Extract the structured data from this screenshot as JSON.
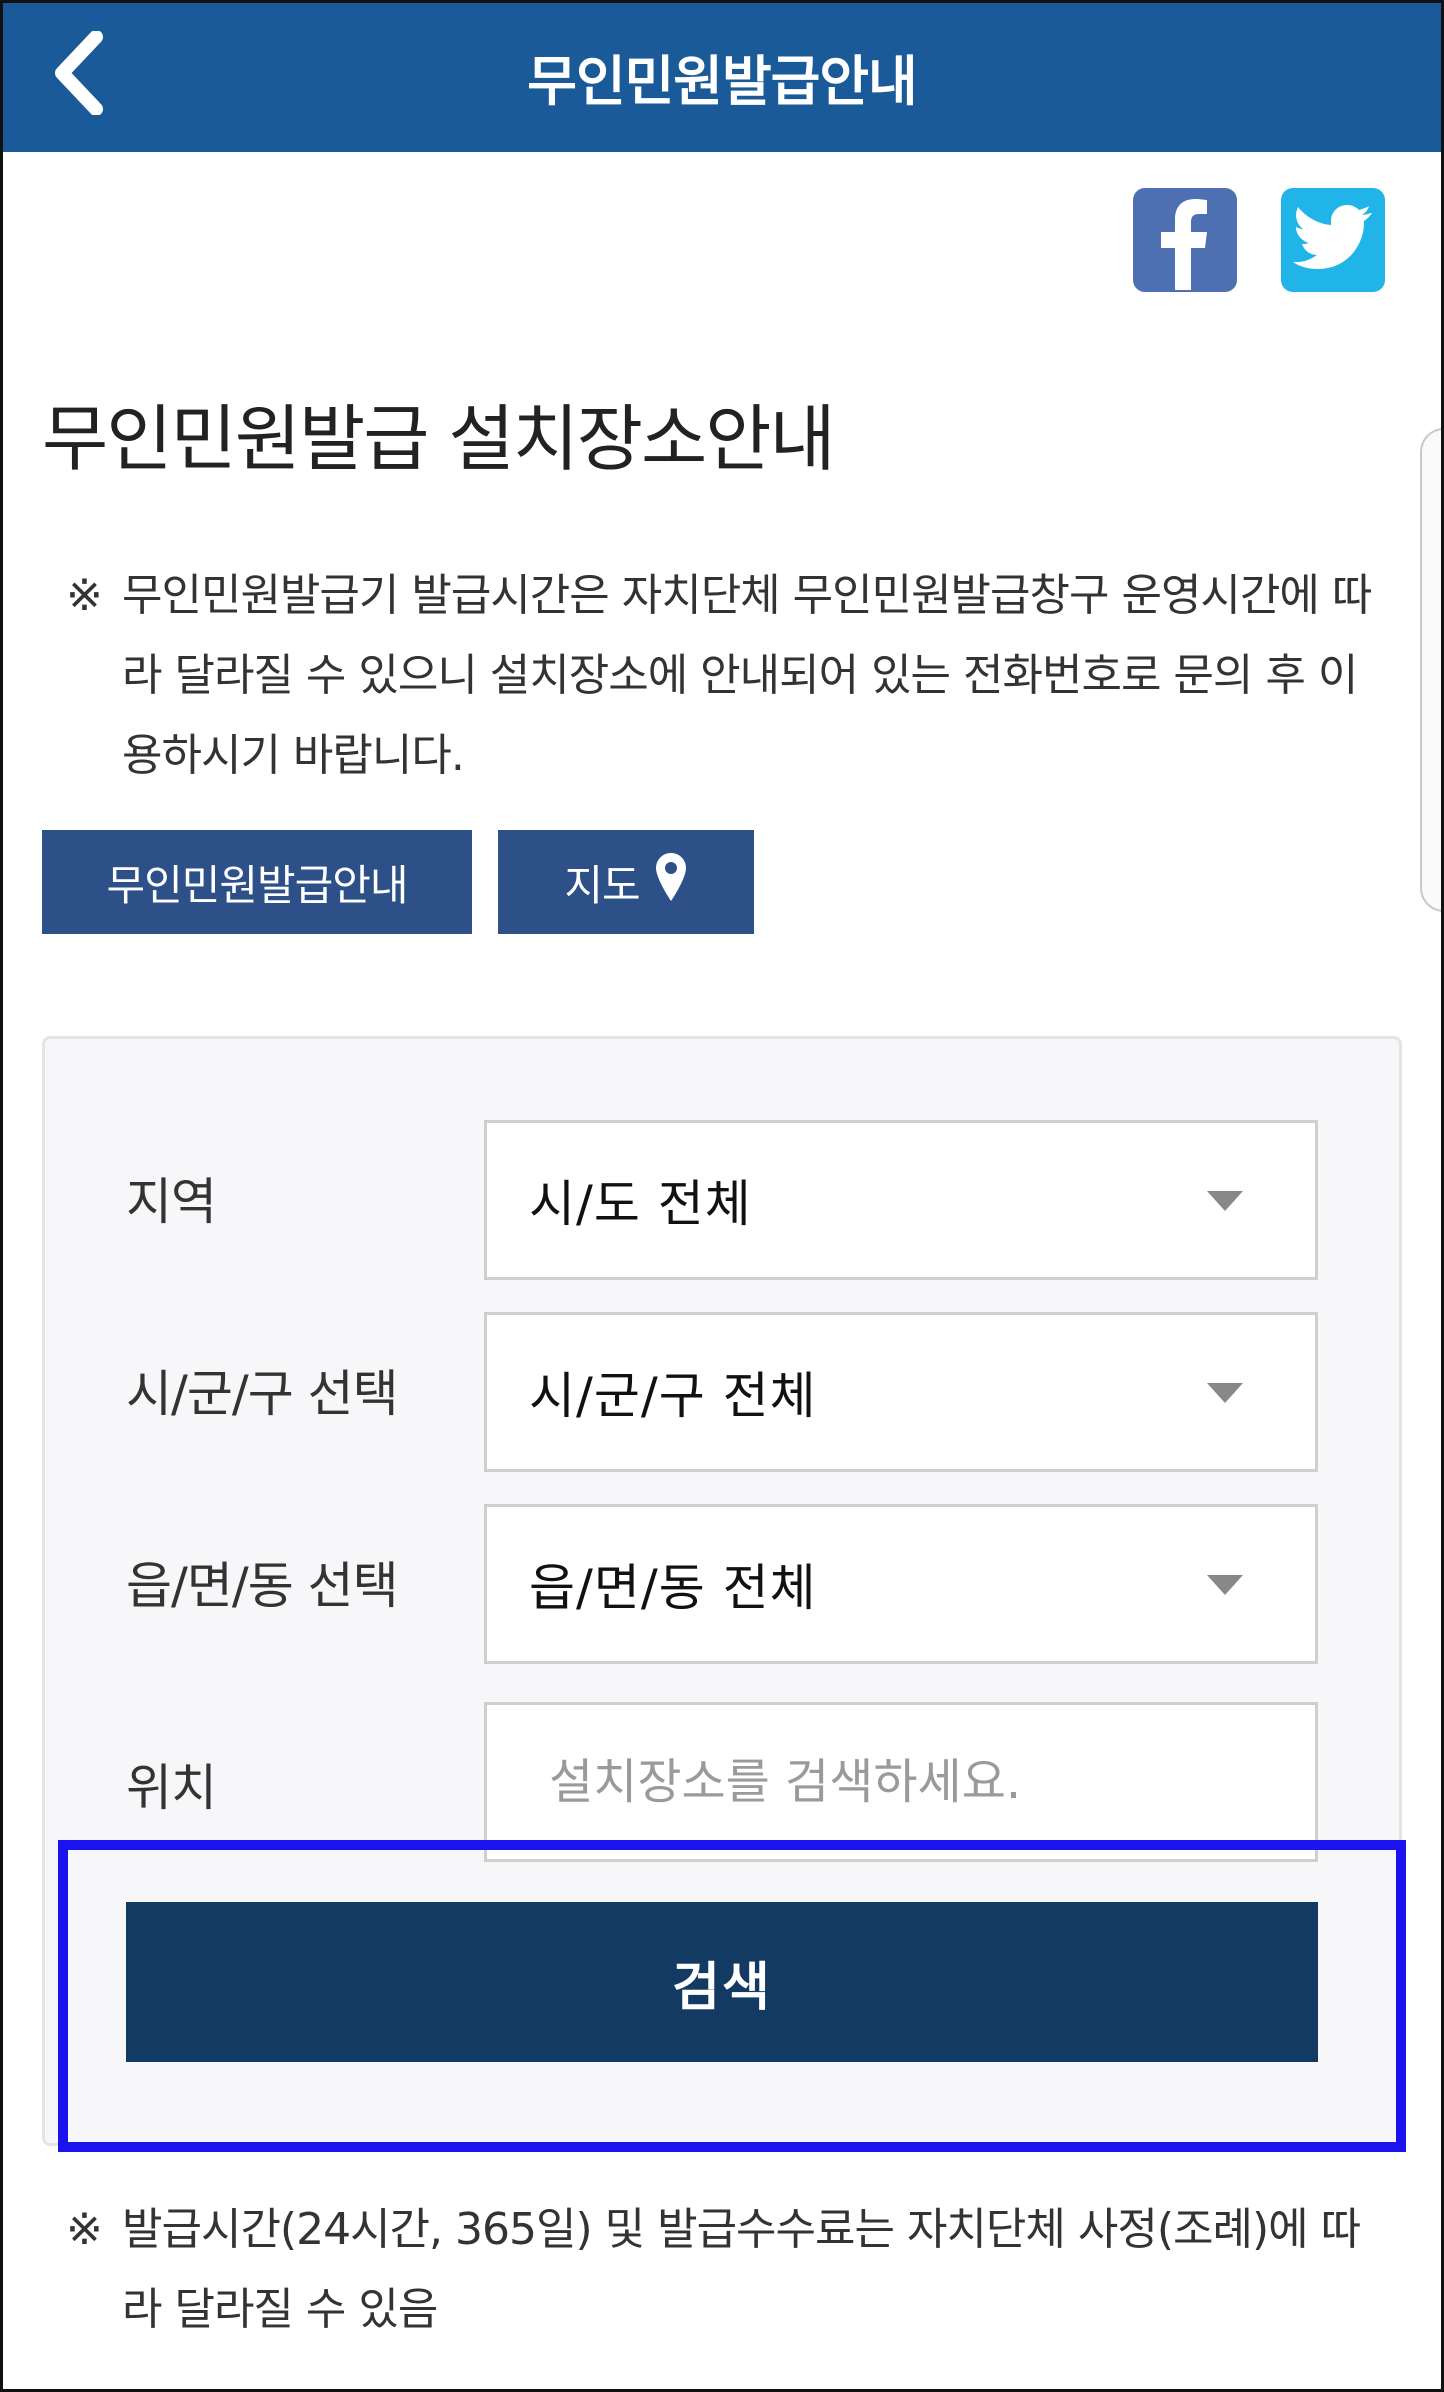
{
  "header": {
    "title": "무인민원발급안내",
    "back_icon": "chevron-left-icon",
    "background": "#1b5a98"
  },
  "share": {
    "facebook_icon": "facebook-icon",
    "twitter_icon": "twitter-icon"
  },
  "page": {
    "title": "무인민원발급 설치장소안내"
  },
  "notice": {
    "mark": "※",
    "text": "무인민원발급기 발급시간은 자치단체 무인민원발급창구 운영시간에 따라 달라질 수 있으니 설치장소에 안내되어 있는 전화번호로 문의 후 이용하시기 바랍니다."
  },
  "buttons": {
    "guide_label": "무인민원발급안내",
    "map_label": "지도",
    "map_icon": "location-pin-icon"
  },
  "search": {
    "region_label": "지역",
    "region_value": "시/도 전체",
    "district_label": "시/군/구 선택",
    "district_value": "시/군/구 전체",
    "town_label": "읍/면/동 선택",
    "town_value": "읍/면/동 전체",
    "location_label": "위치",
    "location_placeholder": "설치장소를 검색하세요.",
    "search_button": "검색"
  },
  "footer_notice": {
    "mark": "※",
    "text": "발급시간(24시간, 365일) 및 발급수수료는 자치단체 사정(조례)에 따라 달라질 수 있음"
  },
  "colors": {
    "button_primary": "#2c5087",
    "search_button": "#123a62",
    "highlight": "#1a13f0"
  }
}
